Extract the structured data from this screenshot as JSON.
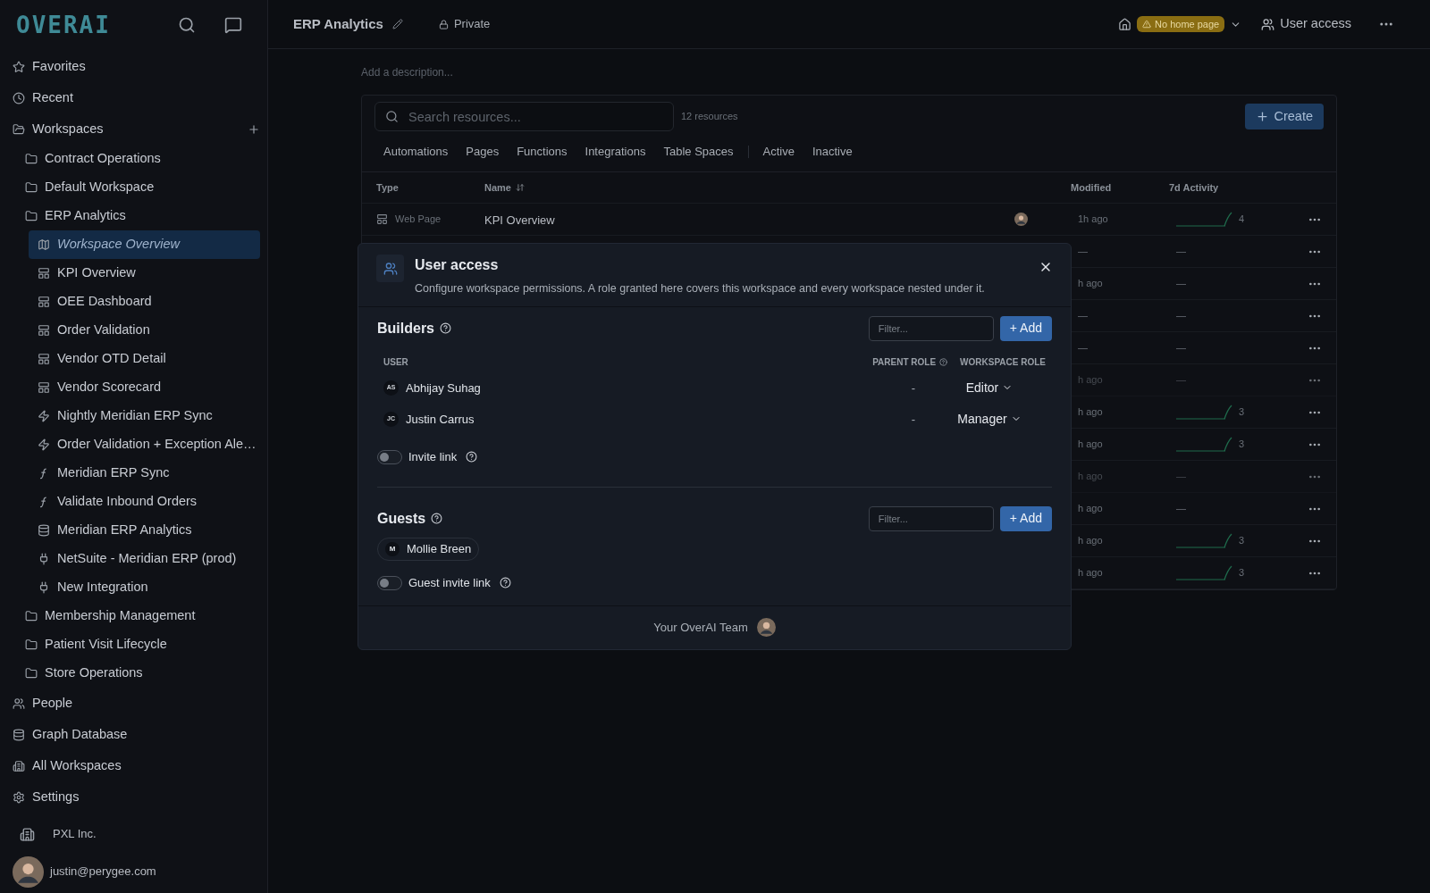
{
  "sidebar": {
    "logo": "OVERAI",
    "nav": [
      {
        "kind": "star",
        "label": "Favorites",
        "selected": false
      },
      {
        "kind": "clock",
        "label": "Recent",
        "selected": false
      },
      {
        "kind": "workspaces",
        "label": "Workspaces",
        "selected": false,
        "children": [
          {
            "kind": "folder",
            "label": "Contract Operations",
            "selected": false
          },
          {
            "kind": "folder",
            "label": "Default Workspace",
            "selected": false
          },
          {
            "kind": "folder",
            "label": "ERP Analytics",
            "selected": false,
            "children": [
              {
                "kind": "map",
                "label": "Workspace Overview",
                "selected": true
              },
              {
                "kind": "page",
                "label": "KPI Overview",
                "selected": false
              },
              {
                "kind": "page",
                "label": "OEE Dashboard",
                "selected": false
              },
              {
                "kind": "page",
                "label": "Order Validation",
                "selected": false
              },
              {
                "kind": "page",
                "label": "Vendor OTD Detail",
                "selected": false
              },
              {
                "kind": "page",
                "label": "Vendor Scorecard",
                "selected": false
              },
              {
                "kind": "automation",
                "label": "Nightly Meridian ERP Sync",
                "selected": false
              },
              {
                "kind": "automation",
                "label": "Order Validation + Exception Ale…",
                "selected": false
              },
              {
                "kind": "function",
                "label": "Meridian ERP Sync",
                "selected": false
              },
              {
                "kind": "function",
                "label": "Validate Inbound Orders",
                "selected": false
              },
              {
                "kind": "database",
                "label": "Meridian ERP Analytics",
                "selected": false
              },
              {
                "kind": "integration",
                "label": "NetSuite - Meridian ERP (prod)",
                "selected": false
              },
              {
                "kind": "integration",
                "label": "New Integration",
                "selected": false
              }
            ]
          },
          {
            "kind": "folder",
            "label": "Membership Management",
            "selected": false
          },
          {
            "kind": "folder",
            "label": "Patient Visit Lifecycle",
            "selected": false
          },
          {
            "kind": "folder",
            "label": "Store Operations",
            "selected": false
          }
        ]
      },
      {
        "kind": "people",
        "label": "People",
        "selected": false
      },
      {
        "kind": "database",
        "label": "Graph Database",
        "selected": false
      },
      {
        "kind": "building",
        "label": "All Workspaces",
        "selected": false
      },
      {
        "kind": "settings",
        "label": "Settings",
        "selected": false
      }
    ],
    "org": "PXL Inc.",
    "user": "justin@perygee.com"
  },
  "header": {
    "title": "ERP Analytics",
    "privacy": "Private",
    "home_badge": "No home page",
    "user_access": "User access"
  },
  "description": {
    "placeholder": "Add a description..."
  },
  "resources": {
    "search": {
      "placeholder": "Search resources..."
    },
    "count": "12 resources",
    "create": "Create",
    "type_filters": [
      {
        "label": "Automations",
        "selected": false
      },
      {
        "label": "Pages",
        "selected": false
      },
      {
        "label": "Functions",
        "selected": false
      },
      {
        "label": "Integrations",
        "selected": false
      },
      {
        "label": "Table Spaces",
        "selected": false
      }
    ],
    "status_filters": [
      {
        "label": "Active",
        "selected": false
      },
      {
        "label": "Inactive",
        "selected": false
      }
    ],
    "columns": [
      "Type",
      "Name",
      "Modified",
      "7d Activity"
    ],
    "rows": [
      {
        "type": "Web Page",
        "name": "KPI Overview",
        "modified": "1h ago",
        "activity": "4",
        "trend": true,
        "dimmed": false
      },
      {
        "modified": "—",
        "activity": "—",
        "trend": false,
        "dimmed": false
      },
      {
        "modified": "h ago",
        "activity": "—",
        "trend": false,
        "dimmed": false
      },
      {
        "modified": "—",
        "activity": "—",
        "trend": false,
        "dimmed": false
      },
      {
        "modified": "—",
        "activity": "—",
        "trend": false,
        "dimmed": false
      },
      {
        "modified": "h ago",
        "activity": "—",
        "trend": false,
        "dimmed": true
      },
      {
        "modified": "h ago",
        "activity": "3",
        "trend": true,
        "dimmed": false
      },
      {
        "modified": "h ago",
        "activity": "3",
        "trend": true,
        "dimmed": false
      },
      {
        "modified": "h ago",
        "activity": "—",
        "trend": false,
        "dimmed": true
      },
      {
        "modified": "h ago",
        "activity": "—",
        "trend": false,
        "dimmed": false
      },
      {
        "modified": "h ago",
        "activity": "3",
        "trend": true,
        "dimmed": false
      },
      {
        "modified": "h ago",
        "activity": "3",
        "trend": true,
        "dimmed": false
      }
    ]
  },
  "modal": {
    "title": "User access",
    "description": "Configure workspace permissions. A role granted here covers this workspace and every workspace nested under it.",
    "builders": {
      "title": "Builders",
      "filter_placeholder": "Filter...",
      "add": "+ Add",
      "columns": [
        "USER",
        "PARENT ROLE",
        "WORKSPACE ROLE"
      ],
      "users": [
        {
          "initials": "AS",
          "name": "Abhijay Suhag",
          "parent_role": "-",
          "role": "Editor"
        },
        {
          "initials": "JC",
          "name": "Justin Carrus",
          "parent_role": "-",
          "role": "Manager"
        }
      ],
      "invite_link": {
        "label": "Invite link",
        "on": false
      }
    },
    "guests": {
      "title": "Guests",
      "filter_placeholder": "Filter...",
      "add": "+ Add",
      "users": [
        {
          "initials": "M",
          "name": "Mollie Breen"
        }
      ],
      "invite_link": {
        "label": "Guest invite link",
        "on": false
      }
    },
    "footer": "Your OverAI Team"
  }
}
